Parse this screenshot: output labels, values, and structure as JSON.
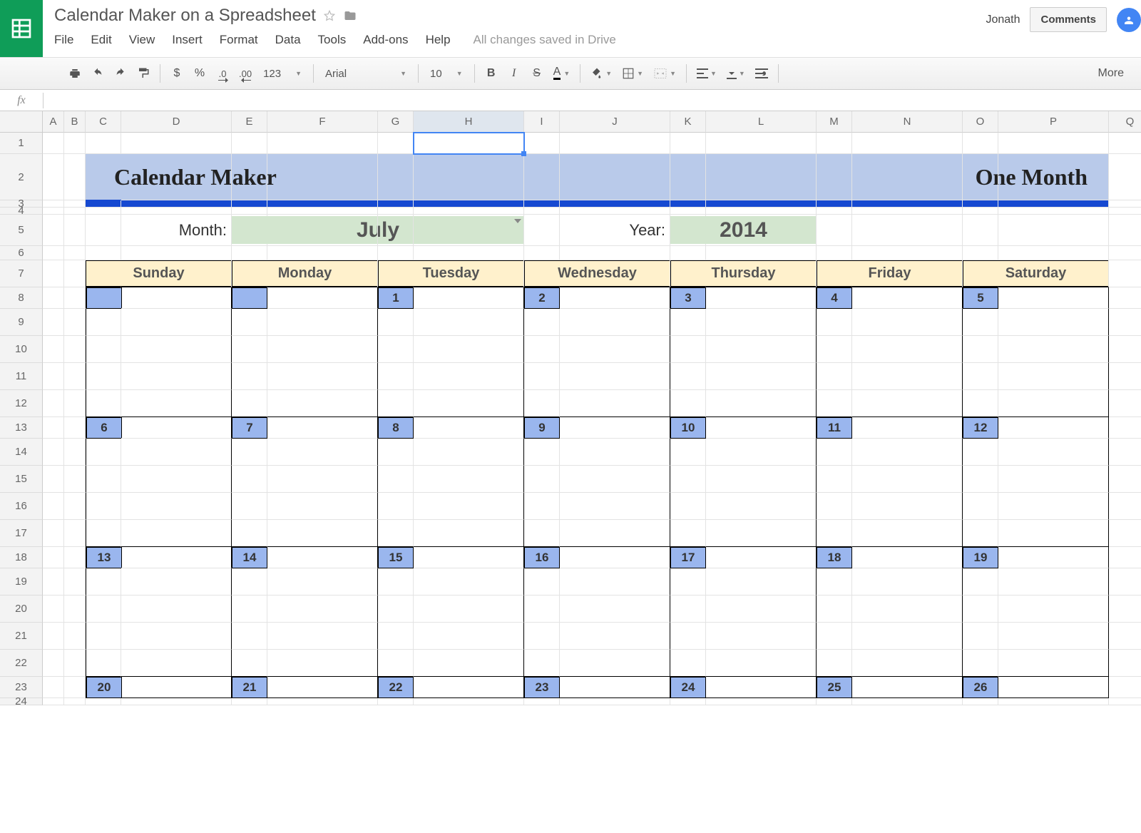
{
  "doc": {
    "title": "Calendar Maker on a Spreadsheet"
  },
  "user": {
    "name": "Jonath"
  },
  "buttons": {
    "comments": "Comments"
  },
  "menu": {
    "items": [
      "File",
      "Edit",
      "View",
      "Insert",
      "Format",
      "Data",
      "Tools",
      "Add-ons",
      "Help"
    ],
    "status": "All changes saved in Drive"
  },
  "toolbar": {
    "currency": "$",
    "percent": "%",
    "dec_dec": ".0",
    "dec_inc": ".00",
    "numfmt": "123",
    "font": "Arial",
    "size": "10",
    "bold": "B",
    "italic": "I",
    "strike": "S",
    "textcolor": "A",
    "more": "More"
  },
  "fx": {
    "label": "fx"
  },
  "columns": [
    "A",
    "B",
    "C",
    "D",
    "E",
    "F",
    "G",
    "H",
    "I",
    "J",
    "K",
    "L",
    "M",
    "N",
    "O",
    "P",
    "Q"
  ],
  "rows": [
    "1",
    "2",
    "3",
    "4",
    "5",
    "6",
    "7",
    "8",
    "9",
    "10",
    "11",
    "12",
    "13",
    "14",
    "15",
    "16",
    "17",
    "18",
    "19",
    "20",
    "21",
    "22",
    "23",
    "24"
  ],
  "sheet": {
    "title_left": "Calendar Maker",
    "title_right": "One Month",
    "month_label": "Month:",
    "month_value": "July",
    "year_label": "Year:",
    "year_value": "2014",
    "day_headers": [
      "Sunday",
      "Monday",
      "Tuesday",
      "Wednesday",
      "Thursday",
      "Friday",
      "Saturday"
    ],
    "weeks": [
      [
        "",
        "",
        "1",
        "2",
        "3",
        "4",
        "5"
      ],
      [
        "6",
        "7",
        "8",
        "9",
        "10",
        "11",
        "12"
      ],
      [
        "13",
        "14",
        "15",
        "16",
        "17",
        "18",
        "19"
      ],
      [
        "20",
        "21",
        "22",
        "23",
        "24",
        "25",
        "26"
      ]
    ]
  }
}
